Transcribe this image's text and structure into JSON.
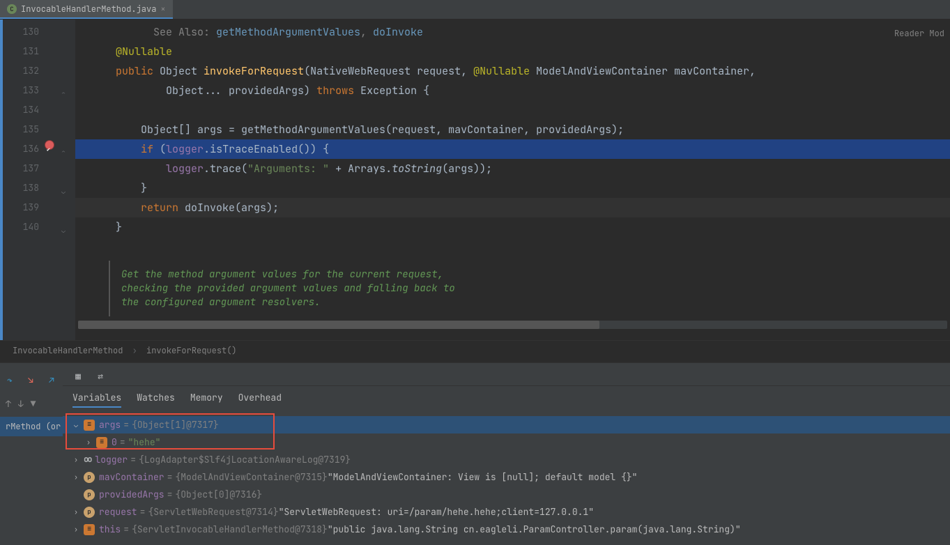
{
  "tab": {
    "filename": "InvocableHandlerMethod.java"
  },
  "reader_mode": "Reader Mod",
  "gutter": [
    "",
    "130",
    "131",
    "132",
    "133",
    "134",
    "135",
    "136",
    "137",
    "138",
    "139",
    "140"
  ],
  "code": {
    "l0_a": "            See Also: ",
    "l0_b": "getMethodArgumentValues",
    "l0_c": ", ",
    "l0_d": "doInvoke",
    "l130_ann": "@Nullable",
    "l131_a": "public ",
    "l131_b": "Object ",
    "l131_c": "invokeForRequest",
    "l131_d": "(NativeWebRequest ",
    "l131_e": "request",
    "l131_f": ", ",
    "l131_g": "@Nullable ",
    "l131_h": "ModelAndViewContainer ",
    "l131_i": "mavContainer",
    "l131_j": ",",
    "l132_a": "Object... ",
    "l132_b": "providedArgs",
    "l132_c": ") ",
    "l132_d": "throws ",
    "l132_e": "Exception {",
    "l134_a": "Object[] ",
    "l134_b": "args",
    "l134_c": " = getMethodArgumentValues(",
    "l134_d": "request",
    "l134_e": ", ",
    "l134_f": "mavContainer",
    "l134_g": ", ",
    "l134_h": "providedArgs",
    "l134_i": ");",
    "l135_a": "if ",
    "l135_b": "(",
    "l135_c": "logger",
    "l135_d": ".isTraceEnabled()) {",
    "l136_a": "logger",
    "l136_b": ".trace(",
    "l136_c": "\"Arguments: \"",
    "l136_d": " + Arrays.",
    "l136_e": "toString",
    "l136_f": "(",
    "l136_g": "args",
    "l136_h": "));",
    "l137": "}",
    "l138_a": "return ",
    "l138_b": "doInvoke(",
    "l138_c": "args",
    "l138_d": ");",
    "l139": "}"
  },
  "doc": {
    "l1": "Get the method argument values for the current request,",
    "l2": "checking the provided argument values and falling back to",
    "l3": "the configured argument resolvers."
  },
  "breadcrumb": {
    "a": "InvocableHandlerMethod",
    "b": "invokeForRequest()"
  },
  "debug": {
    "tabs": {
      "variables": "Variables",
      "watches": "Watches",
      "memory": "Memory",
      "overhead": "Overhead"
    },
    "stack": "rMethod (or",
    "vars": {
      "args_name": "args",
      "args_val": "{Object[1]@7317}",
      "idx0_name": "0",
      "idx0_val": "\"hehe\"",
      "logger_name": "logger",
      "logger_val": "{LogAdapter$Slf4jLocationAwareLog@7319}",
      "mav_name": "mavContainer",
      "mav_val": "{ModelAndViewContainer@7315}",
      "mav_str": " \"ModelAndViewContainer: View is [null]; default model {}\"",
      "prov_name": "providedArgs",
      "prov_val": "{Object[0]@7316}",
      "req_name": "request",
      "req_val": "{ServletWebRequest@7314}",
      "req_str": " \"ServletWebRequest: uri=/param/hehe.hehe;client=127.0.0.1\"",
      "this_name": "this",
      "this_val": "{ServletInvocableHandlerMethod@7318}",
      "this_str": " \"public java.lang.String cn.eagleli.ParamController.param(java.lang.String)\""
    }
  }
}
